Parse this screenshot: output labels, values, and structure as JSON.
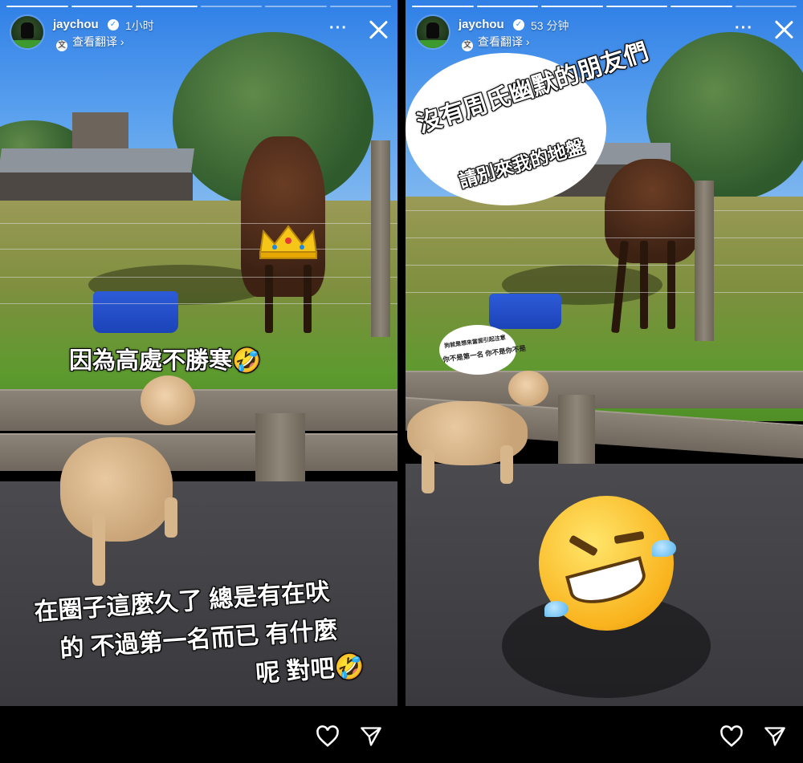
{
  "stories": [
    {
      "user": {
        "username": "jaychou",
        "time_ago": "1小时",
        "translate_label": "查看翻译 ›"
      },
      "progress": {
        "segments": 6,
        "active_index": 2
      },
      "captions": {
        "top": "因為高處不勝寒🤣",
        "bottom_line1": "在圈子這麼久了 總是有在吠",
        "bottom_line2": "的 不過第一名而已 有什麼",
        "bottom_line3": "呢 對吧🤣"
      }
    },
    {
      "user": {
        "username": "jaychou",
        "time_ago": "53 分钟",
        "translate_label": "查看翻译 ›"
      },
      "progress": {
        "segments": 6,
        "active_index": 4
      },
      "captions": {
        "top_line1": "沒有周氏幽默的朋友們",
        "top_line2": "請別來我的地盤",
        "bubble_line1": "狗就是想來當面引起注意",
        "bubble_line2": "你不是第一名 你不是你不是"
      }
    }
  ],
  "icons": {
    "more": "more-options-icon",
    "close": "close-icon",
    "verified": "verified-badge-icon",
    "translate": "translate-icon",
    "heart": "heart-icon",
    "send": "send-icon",
    "crown": "crown-emoji",
    "laugh": "rolling-laughing-emoji"
  },
  "colors": {
    "sky": "#2f7fe6",
    "grass": "#5d9a2e",
    "bucket": "#2d5bd8",
    "verified": "#3897f0"
  }
}
